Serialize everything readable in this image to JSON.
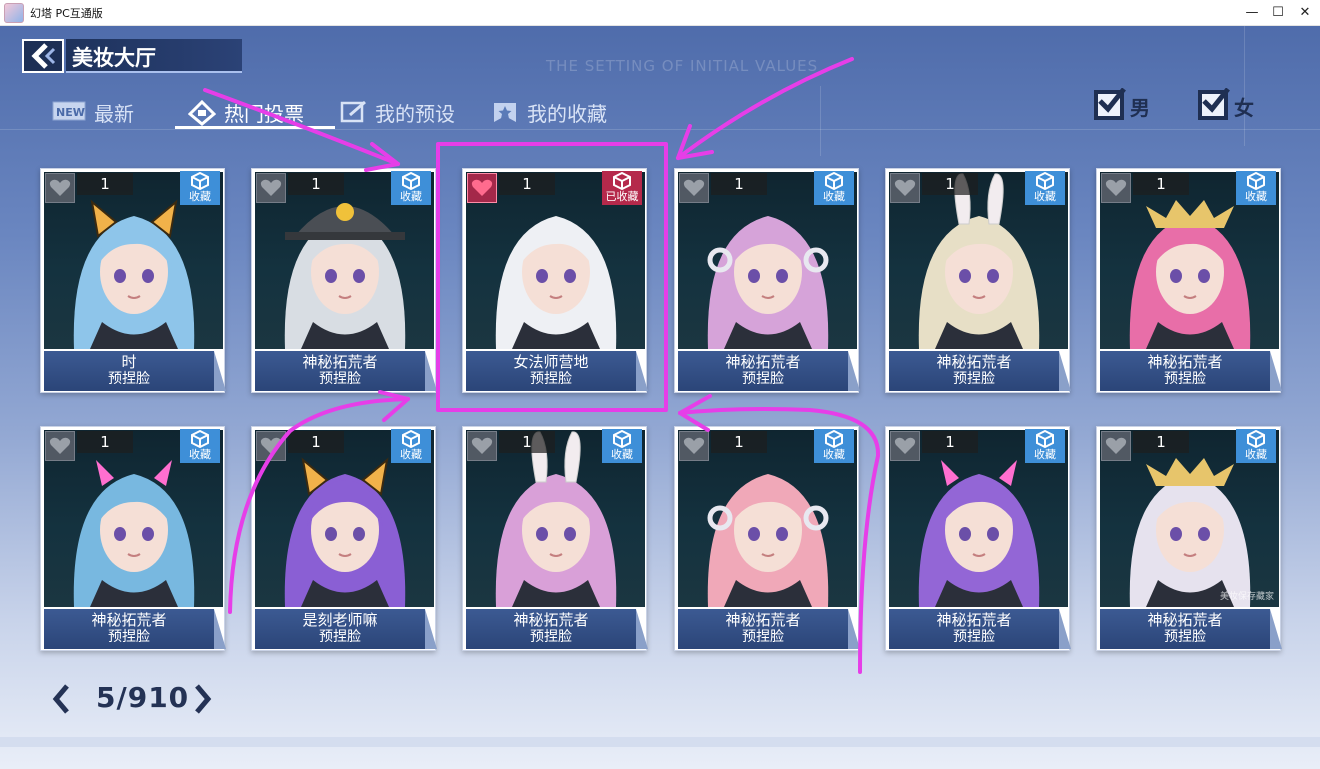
{
  "window": {
    "title": "幻塔  PC互通版",
    "min_glyph": "—",
    "max_glyph": "☐",
    "close_glyph": "✕"
  },
  "header": {
    "title": "美妆大厅"
  },
  "background_text": "THE SETTING OF INITIAL VALUES",
  "tabs": [
    {
      "icon": "new-icon",
      "badge": "NEW",
      "label": "最新"
    },
    {
      "icon": "vote-icon",
      "label": "热门投票",
      "active": true
    },
    {
      "icon": "edit-icon",
      "label": "我的预设"
    },
    {
      "icon": "star-icon",
      "label": "我的收藏"
    }
  ],
  "filters": [
    {
      "label": "男",
      "checked": true
    },
    {
      "label": "女",
      "checked": true
    }
  ],
  "cards": [
    {
      "name": "时",
      "sub": "预捏脸",
      "likes": "1",
      "fav": "收藏",
      "liked": false,
      "saved": false,
      "hair": "#8ec5ea",
      "ears": "cat"
    },
    {
      "name": "神秘拓荒者",
      "sub": "预捏脸",
      "likes": "1",
      "fav": "收藏",
      "liked": false,
      "saved": false,
      "hair": "#d8dde3",
      "ears": "cap"
    },
    {
      "name": "女法师营地",
      "sub": "预捏脸",
      "likes": "1",
      "fav": "已收藏",
      "liked": true,
      "saved": true,
      "hair": "#eef0f4",
      "ears": "none"
    },
    {
      "name": "神秘拓荒者",
      "sub": "预捏脸",
      "likes": "1",
      "fav": "收藏",
      "liked": false,
      "saved": false,
      "hair": "#d6a3d9",
      "ears": "phones"
    },
    {
      "name": "神秘拓荒者",
      "sub": "预捏脸",
      "likes": "1",
      "fav": "收藏",
      "liked": false,
      "saved": false,
      "hair": "#e7dfc6",
      "ears": "bunny"
    },
    {
      "name": "神秘拓荒者",
      "sub": "预捏脸",
      "likes": "1",
      "fav": "收藏",
      "liked": false,
      "saved": false,
      "hair": "#e86ea8",
      "ears": "crown"
    },
    {
      "name": "神秘拓荒者",
      "sub": "预捏脸",
      "likes": "1",
      "fav": "收藏",
      "liked": false,
      "saved": false,
      "hair": "#78b8e0",
      "ears": "horns"
    },
    {
      "name": "是刻老师嘛",
      "sub": "预捏脸",
      "likes": "1",
      "fav": "收藏",
      "liked": false,
      "saved": false,
      "hair": "#8a5fd4",
      "ears": "cat"
    },
    {
      "name": "神秘拓荒者",
      "sub": "预捏脸",
      "likes": "1",
      "fav": "收藏",
      "liked": false,
      "saved": false,
      "hair": "#d9a0d8",
      "ears": "bunny"
    },
    {
      "name": "神秘拓荒者",
      "sub": "预捏脸",
      "likes": "1",
      "fav": "收藏",
      "liked": false,
      "saved": false,
      "hair": "#f0a8b8",
      "ears": "phones"
    },
    {
      "name": "神秘拓荒者",
      "sub": "预捏脸",
      "likes": "1",
      "fav": "收藏",
      "liked": false,
      "saved": false,
      "hair": "#9366d6",
      "ears": "horns"
    },
    {
      "name": "神秘拓荒者",
      "sub": "预捏脸",
      "likes": "1",
      "fav": "收藏",
      "liked": false,
      "saved": false,
      "hair": "#e6e2ee",
      "ears": "crown"
    }
  ],
  "watermark": "美妆保存藏家",
  "pagination": {
    "page": "5/910",
    "prev": "prev-arrow",
    "next": "next-arrow"
  },
  "colors": {
    "accent_fav": "#3e8fd8",
    "saved": "#b5294b",
    "annotation": "#e63ee8"
  }
}
